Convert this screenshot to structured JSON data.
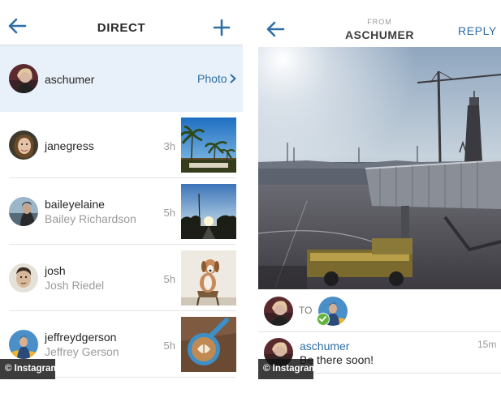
{
  "left": {
    "header": {
      "title": "DIRECT",
      "back_icon": "back-arrow-icon",
      "compose_icon": "plus-icon"
    },
    "threads": [
      {
        "username": "aschumer",
        "subtitle": "",
        "time": "",
        "action_label": "Photo",
        "active": true
      },
      {
        "username": "janegress",
        "subtitle": "",
        "time": "3h",
        "thumbnail": "palm-trees-photo"
      },
      {
        "username": "baileyelaine",
        "subtitle": "Bailey Richardson",
        "time": "5h",
        "thumbnail": "sunset-street-photo"
      },
      {
        "username": "josh",
        "subtitle": "Josh Riedel",
        "time": "5h",
        "thumbnail": "dog-on-chair-photo"
      },
      {
        "username": "jeffreydgerson",
        "subtitle": "Jeffrey Gerson",
        "time": "5h",
        "thumbnail": "latte-art-photo"
      }
    ]
  },
  "right": {
    "header": {
      "from_label": "FROM",
      "sender": "ASCHUMER",
      "reply_label": "REPLY",
      "back_icon": "back-arrow-icon"
    },
    "photo": "airport-tarmac-photo",
    "to_label": "TO",
    "comment": {
      "username": "aschumer",
      "time": "15m",
      "text": "Be there soon!"
    }
  },
  "watermark": {
    "left": "© Instagram",
    "right": "© Instagram"
  },
  "colors": {
    "accent": "#2f6ea5",
    "active_row": "#e8f1f9",
    "muted": "#9a9a9a",
    "check": "#63b33f"
  }
}
